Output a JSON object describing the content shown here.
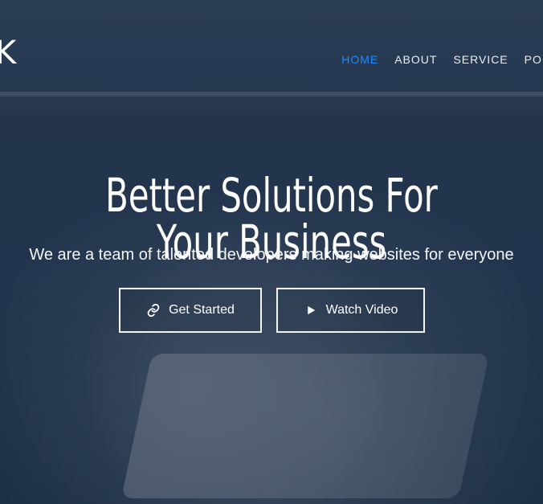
{
  "brand": {
    "logo_text": "K"
  },
  "nav": {
    "items": [
      {
        "label": "HOME",
        "active": true
      },
      {
        "label": "ABOUT",
        "active": false
      },
      {
        "label": "SERVICE",
        "active": false
      },
      {
        "label": "POR",
        "active": false
      }
    ]
  },
  "hero": {
    "title": "Better Solutions For Your Business",
    "subtitle": "We are a team of talented developers making websites for everyone",
    "buttons": [
      {
        "label": "Get Started",
        "icon": "link-icon"
      },
      {
        "label": "Watch Video",
        "icon": "play-icon"
      }
    ]
  },
  "colors": {
    "accent": "#1e88ff",
    "text": "#ffffff",
    "overlay": "#1f2d3f"
  }
}
